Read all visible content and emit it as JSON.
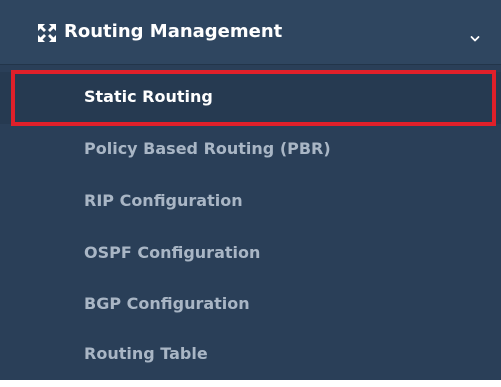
{
  "header": {
    "title": "Routing Management",
    "icon": "expand-arrows-icon",
    "chevron": "chevron-down-icon"
  },
  "submenu": {
    "items": [
      {
        "label": "Static Routing",
        "active": true
      },
      {
        "label": "Policy Based Routing (PBR)",
        "active": false
      },
      {
        "label": "RIP Configuration",
        "active": false
      },
      {
        "label": "OSPF Configuration",
        "active": false
      },
      {
        "label": "BGP Configuration",
        "active": false
      },
      {
        "label": "Routing Table",
        "active": false
      }
    ]
  },
  "colors": {
    "panel_bg": "#2a3f58",
    "active_text": "#ffffff",
    "inactive_text": "#a9b6c5",
    "highlight_border": "#e0202a"
  }
}
